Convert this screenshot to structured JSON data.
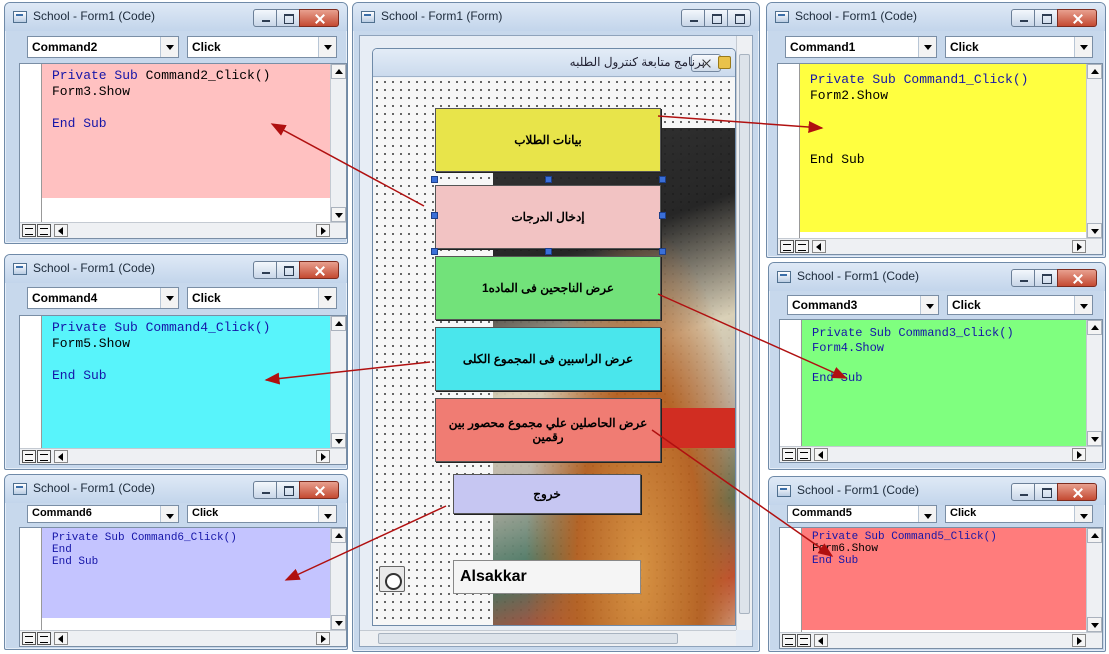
{
  "code_windows": [
    {
      "id": "cw2",
      "title": "School - Form1 (Code)",
      "object": "Command2",
      "proc": "Click",
      "bg": "#ffc1c1",
      "line1_kw": "Private Sub",
      "line1_rest": " Command2_Click()",
      "line2": "Form3.Show",
      "line3": "",
      "end_kw": "End Sub"
    },
    {
      "id": "cw4",
      "title": "School - Form1 (Code)",
      "object": "Command4",
      "proc": "Click",
      "bg": "#58f4fb",
      "line1_kw": "Private Sub",
      "line1_rest": " Command4_Click()",
      "line2": "Form5.Show",
      "line3": "",
      "end_kw": "End Sub"
    },
    {
      "id": "cw6",
      "title": "School - Form1 (Code)",
      "object": "Command6",
      "proc": "Click",
      "bg": "#c4c4ff",
      "line1_kw": "Private Sub",
      "line1_rest": " Command6_Click()",
      "line2": "End",
      "line3": "",
      "end_kw": "End Sub"
    },
    {
      "id": "cw1",
      "title": "School - Form1 (Code)",
      "object": "Command1",
      "proc": "Click",
      "bg": "#ffff40",
      "line1_kw": "Private Sub",
      "line1_rest": " Command1_Click()",
      "line2": "Form2.Show",
      "line3": "",
      "end_kw": "End Sub"
    },
    {
      "id": "cw3",
      "title": "School - Form1 (Code)",
      "object": "Command3",
      "proc": "Click",
      "bg": "#7fff7f",
      "line1_kw": "Private Sub",
      "line1_rest": " Command3_Click()",
      "line2": "Form4.Show",
      "line3": "",
      "end_kw": "End Sub"
    },
    {
      "id": "cw5",
      "title": "School - Form1 (Code)",
      "object": "Command5",
      "proc": "Click",
      "bg": "#ff7c7c",
      "line1_kw": "Private Sub",
      "line1_rest": " Command5_Click()",
      "line2": "Form6.Show",
      "line3": "",
      "end_kw": "End Sub"
    }
  ],
  "form_window": {
    "title": "School - Form1 (Form)",
    "inner_title": "برنامج متابعة كنترول الطلبه",
    "label_text": "Alsakkar"
  },
  "buttons": [
    {
      "name": "command1-button",
      "text": "بيانات الطلاب",
      "color": "#e8e44a"
    },
    {
      "name": "command2-button",
      "text": "إدخال الدرجات",
      "color": "#f2c3c3"
    },
    {
      "name": "command3-button",
      "text": "عرض الناجحين فى الماده1",
      "color": "#72e27a"
    },
    {
      "name": "command4-button",
      "text": "عرض الراسبين فى المجموع الكلى",
      "color": "#4ae6ec"
    },
    {
      "name": "command5-button",
      "text": "عرض الحاصلين علي مجموع محصور بين رقمين",
      "color": "#f07c73"
    },
    {
      "name": "command6-button",
      "text": "خروج",
      "color": "#c6c6f2"
    }
  ],
  "colors": {
    "arrow": "#b01010",
    "keyword": "#1515a8"
  }
}
